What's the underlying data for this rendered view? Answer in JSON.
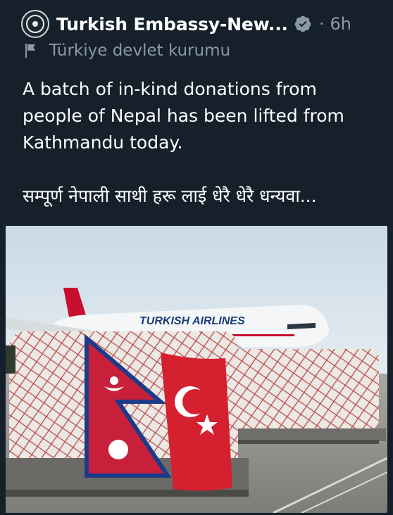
{
  "tweet": {
    "author_name": "Turkish Embassy-New...",
    "timestamp": "6h",
    "separator": "·",
    "account_label": "Türkiye devlet kurumu",
    "body_line1": "A batch of in-kind donations from people of Nepal has been lifted from Kathmandu today.",
    "body_line2": "सम्पूर्ण नेपाली साथी हरू लाई धेरै धेरै धन्यवा..."
  },
  "media": {
    "airline_text": "TURKISH AIRLINES"
  },
  "colors": {
    "background": "#15202b",
    "secondary_text": "#8b98a5",
    "verified_badge": "#8b98a5"
  }
}
